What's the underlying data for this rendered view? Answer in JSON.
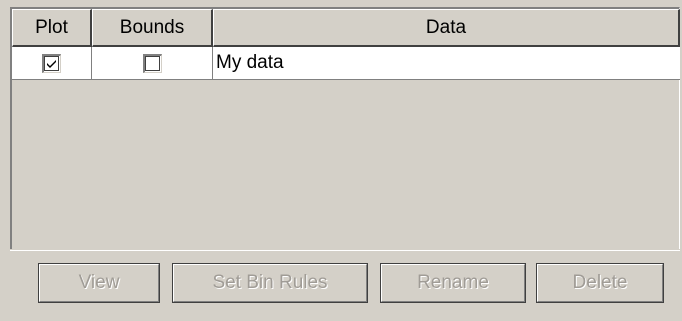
{
  "table": {
    "columns": [
      "Plot",
      "Bounds",
      "Data"
    ],
    "rows": [
      {
        "plot_checked": true,
        "bounds_checked": false,
        "data": "My data"
      }
    ]
  },
  "buttons": {
    "view": "View",
    "set_bin_rules": "Set Bin Rules",
    "rename": "Rename",
    "delete": "Delete"
  },
  "icons": {
    "plot_checkbox": "checkbox-checked-icon",
    "bounds_checkbox": "checkbox-unchecked-icon"
  },
  "colors": {
    "background": "#d4d0c8",
    "disabled_text": "#a09c96"
  }
}
